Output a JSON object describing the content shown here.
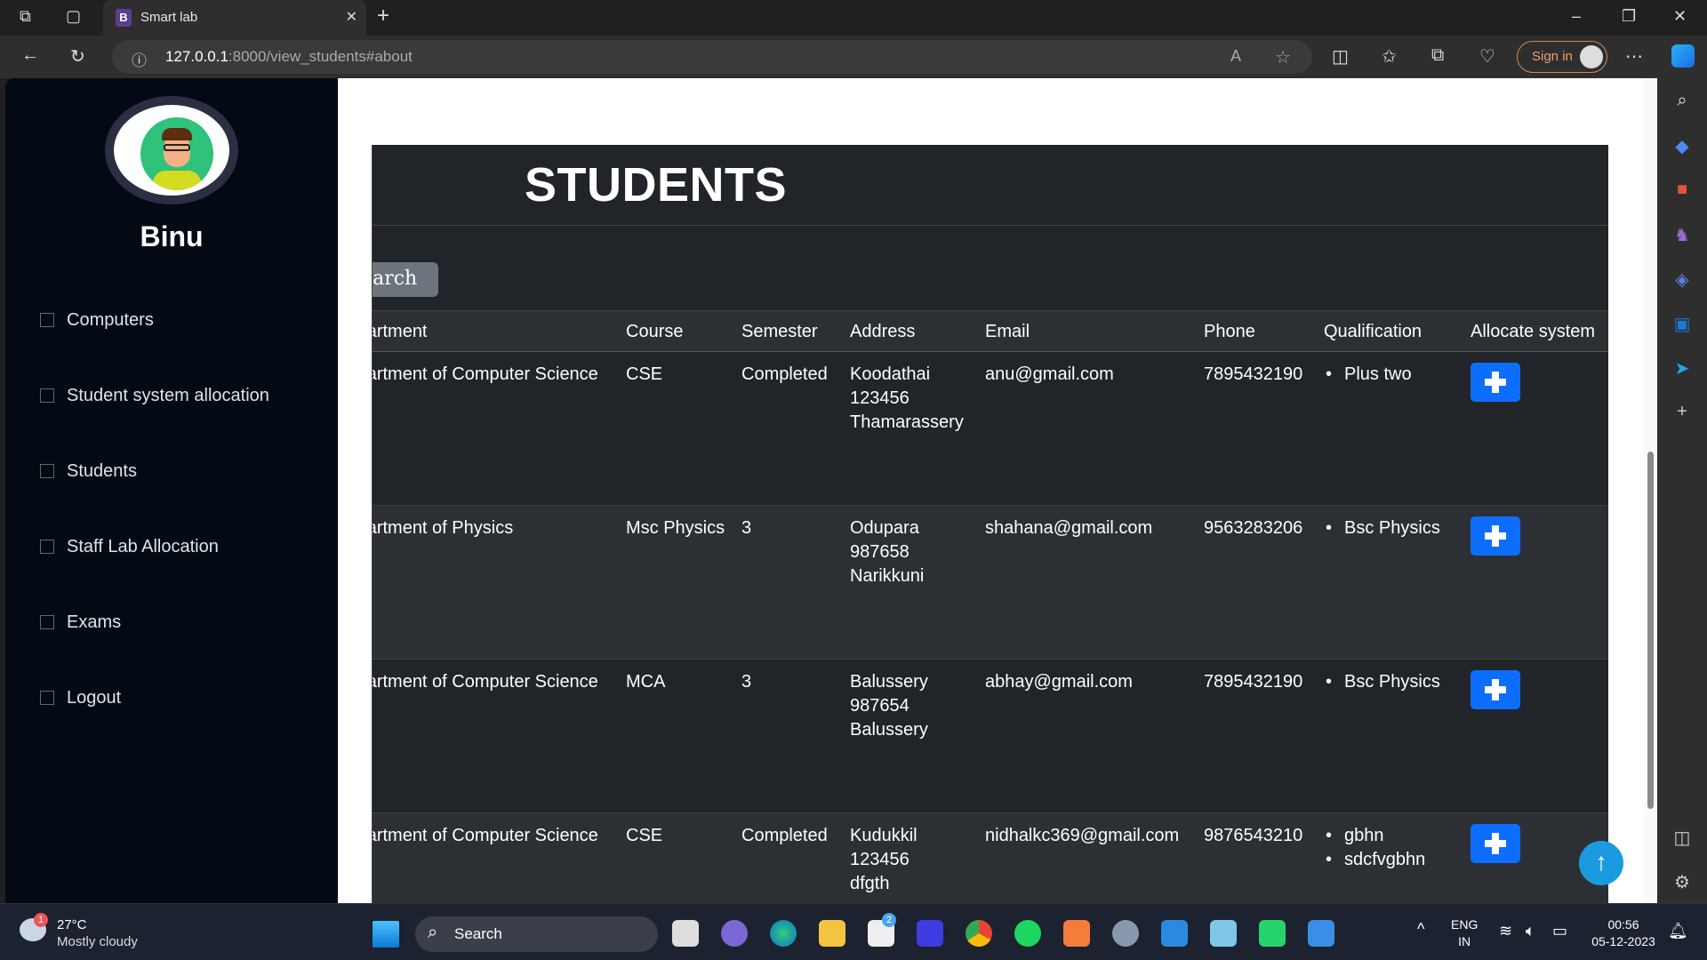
{
  "browser": {
    "tab_title": "Smart lab",
    "tab_favicon": "B",
    "url_host": "127.0.0.1",
    "url_rest": ":8000/view_students#about",
    "sign_in": "Sign in"
  },
  "sidebar": {
    "username": "Binu",
    "items": [
      {
        "label": "Computers"
      },
      {
        "label": "Student system allocation"
      },
      {
        "label": "Students"
      },
      {
        "label": "Staff Lab Allocation"
      },
      {
        "label": "Exams"
      },
      {
        "label": "Logout"
      }
    ]
  },
  "main": {
    "title": "STUDENTS",
    "search_label": "Search",
    "columns": [
      "Department",
      "Course",
      "Semester",
      "Address",
      "Email",
      "Phone",
      "Qualification",
      "Allocate system"
    ],
    "rows": [
      {
        "department": "Department of Computer Science",
        "course": "CSE",
        "semester": "Completed",
        "address": [
          "Koodathai",
          "123456",
          "Thamarassery"
        ],
        "email": "anu@gmail.com",
        "phone": "7895432190",
        "qualification": [
          "Plus two"
        ]
      },
      {
        "department": "Department of Physics",
        "course": "Msc Physics",
        "semester": "3",
        "address": [
          "Odupara",
          "987658",
          "Narikkuni"
        ],
        "email": "shahana@gmail.com",
        "phone": "9563283206",
        "qualification": [
          "Bsc Physics"
        ]
      },
      {
        "department": "Department of Computer Science",
        "course": "MCA",
        "semester": "3",
        "address": [
          "Balussery",
          "987654",
          "Balussery"
        ],
        "email": "abhay@gmail.com",
        "phone": "7895432190",
        "qualification": [
          "Bsc Physics"
        ]
      },
      {
        "department": "Department of Computer Science",
        "course": "CSE",
        "semester": "Completed",
        "address": [
          "Kudukkil",
          "123456",
          "dfgth"
        ],
        "email": "nidhalkc369@gmail.com",
        "phone": "9876543210",
        "qualification": [
          "gbhn",
          "sdcfvgbhn"
        ]
      }
    ]
  },
  "taskbar": {
    "temperature": "27°C",
    "weather": "Mostly cloudy",
    "weather_badge": "1",
    "search": "Search",
    "store_badge": "2",
    "lang": "ENG",
    "region": "IN",
    "time": "00:56",
    "date": "05-12-2023"
  },
  "colors": {
    "accent": "#0d6efd",
    "sidebar_bg": "#040a14",
    "panel_bg": "#212529",
    "to_top": "#1a9be0"
  }
}
